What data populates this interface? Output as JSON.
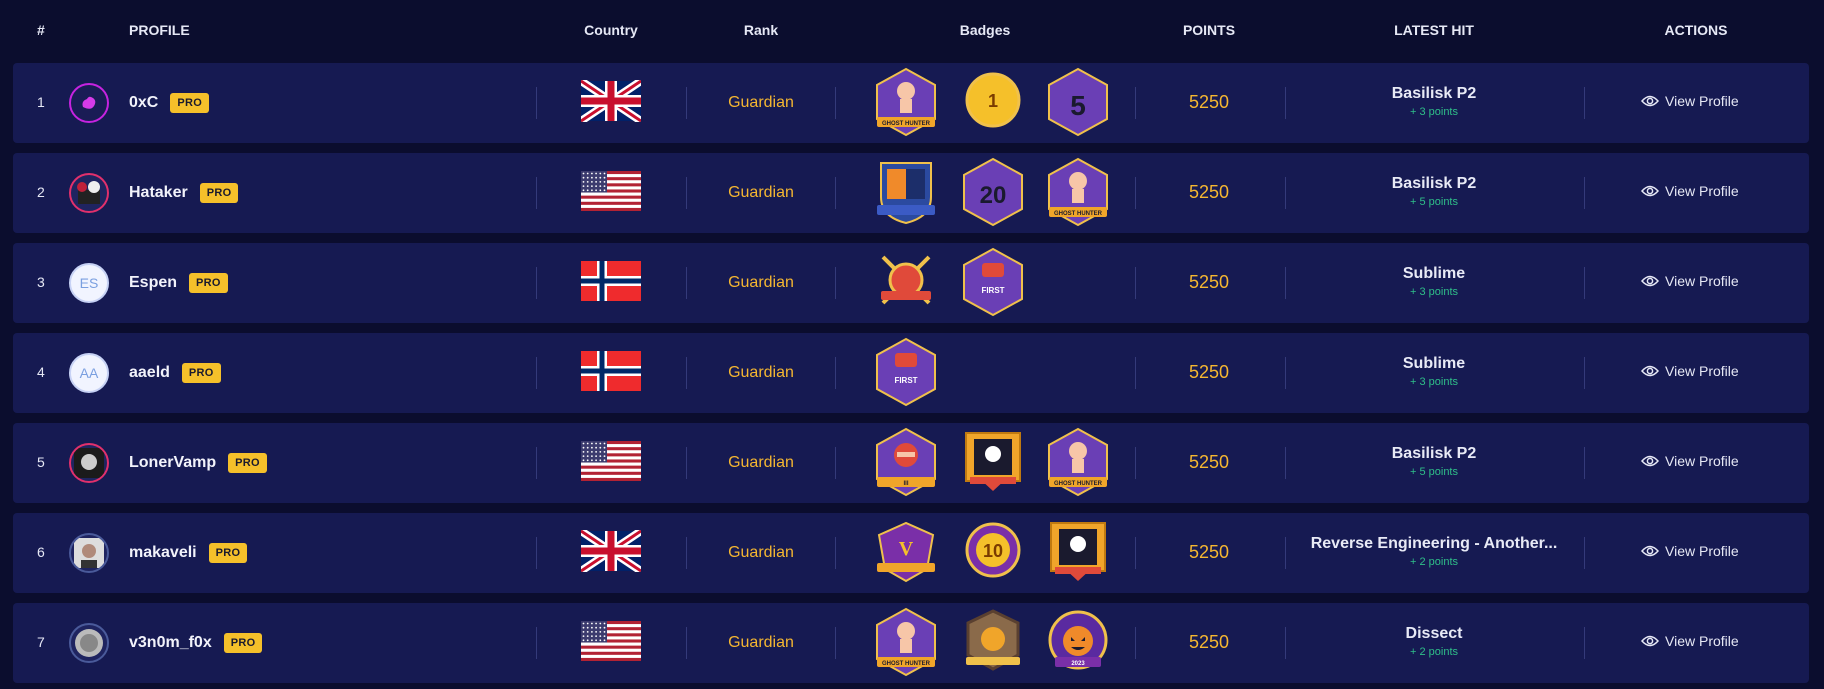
{
  "header": {
    "num": "#",
    "profile": "PROFILE",
    "country": "Country",
    "rank": "Rank",
    "badges": "Badges",
    "points": "POINTS",
    "latest_hit": "LATEST HIT",
    "actions": "ACTIONS"
  },
  "colors": {
    "background": "#0b0d2e",
    "row": "#161a52",
    "accent_gold": "#f5b731",
    "pro_badge": "#f5c02a",
    "points_green": "#2fbf89"
  },
  "rows": [
    {
      "num": "1",
      "avatar": "pink-blob-icon",
      "username": "0xC",
      "pro": "PRO",
      "country_flag": "uk-flag-icon",
      "rank": "Guardian",
      "badges": [
        "ghost-hunter-badge-icon",
        "no-1-global-medal-icon",
        "5-first-blood-badge-icon"
      ],
      "points": "5250",
      "latest_title": "Basilisk P2",
      "latest_points": "+ 3 points",
      "action": "View Profile"
    },
    {
      "num": "2",
      "avatar": "hacker-avatar-icon",
      "username": "Hataker",
      "pro": "PRO",
      "country_flag": "usa-flag-icon",
      "rank": "Guardian",
      "badges": [
        "hacker-shield-badge-icon",
        "20-first-blood-badge-icon",
        "ghost-hunter-badge-icon"
      ],
      "points": "5250",
      "latest_title": "Basilisk P2",
      "latest_points": "+ 5 points",
      "action": "View Profile"
    },
    {
      "num": "3",
      "avatar": "initials-avatar",
      "avatar_text": "ES",
      "username": "Espen",
      "pro": "PRO",
      "country_flag": "norway-flag-icon",
      "rank": "Guardian",
      "badges": [
        "crossed-swords-badge-icon",
        "first-blood-badge-icon"
      ],
      "points": "5250",
      "latest_title": "Sublime",
      "latest_points": "+ 3 points",
      "action": "View Profile"
    },
    {
      "num": "4",
      "avatar": "initials-avatar",
      "avatar_text": "AA",
      "username": "aaeld",
      "pro": "PRO",
      "country_flag": "norway-flag-icon",
      "rank": "Guardian",
      "badges": [
        "first-blood-badge-icon"
      ],
      "points": "5250",
      "latest_title": "Sublime",
      "latest_points": "+ 3 points",
      "action": "View Profile"
    },
    {
      "num": "5",
      "avatar": "vampire-avatar-icon",
      "username": "LonerVamp",
      "pro": "PRO",
      "country_flag": "usa-flag-icon",
      "rank": "Guardian",
      "badges": [
        "ninja-badge-icon",
        "reverser-skull-badge-icon",
        "ghost-hunter-badge-icon"
      ],
      "points": "5250",
      "latest_title": "Basilisk P2",
      "latest_points": "+ 5 points",
      "action": "View Profile"
    },
    {
      "num": "6",
      "avatar": "person-avatar-icon",
      "username": "makaveli",
      "pro": "PRO",
      "country_flag": "uk-flag-icon",
      "rank": "Guardian",
      "badges": [
        "v-shield-badge-icon",
        "10-global-medal-icon",
        "reverser-skull-badge-icon"
      ],
      "points": "5250",
      "latest_title": "Reverse Engineering - Another...",
      "latest_points": "+ 2 points",
      "action": "View Profile"
    },
    {
      "num": "7",
      "avatar": "coin-avatar-icon",
      "username": "v3n0m_f0x",
      "pro": "PRO",
      "country_flag": "usa-flag-icon",
      "rank": "Guardian",
      "badges": [
        "ghost-hunter-badge-icon",
        "bronze-shield-badge-icon",
        "trick-or-treat-2023-badge-icon"
      ],
      "points": "5250",
      "latest_title": "Dissect",
      "latest_points": "+ 2 points",
      "action": "View Profile"
    }
  ]
}
